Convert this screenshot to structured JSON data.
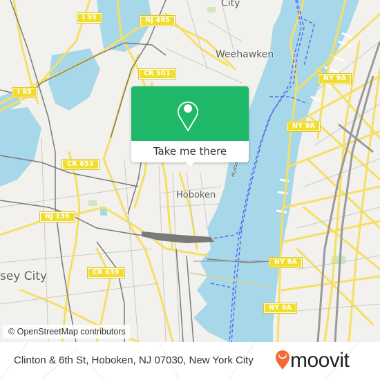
{
  "map": {
    "place_labels": [
      {
        "name": "union-city-label",
        "text": "City"
      },
      {
        "name": "weehawken-label",
        "text": "Weehawken"
      },
      {
        "name": "hoboken-label",
        "text": "Hoboken"
      },
      {
        "name": "jersey-city-label",
        "text": "sey City"
      },
      {
        "name": "hudson-river-label",
        "text": "Hudson River"
      }
    ],
    "road_shields": [
      {
        "name": "shield-i95-north",
        "text": "I 95"
      },
      {
        "name": "shield-nj495",
        "text": "NJ 495"
      },
      {
        "name": "shield-cr501",
        "text": "CR 501"
      },
      {
        "name": "shield-i95-west",
        "text": "I 95"
      },
      {
        "name": "shield-ny9a-1",
        "text": "NY 9A"
      },
      {
        "name": "shield-ny9a-2",
        "text": "NY 9A"
      },
      {
        "name": "shield-cr653",
        "text": "CR 653"
      },
      {
        "name": "shield-nj139",
        "text": "NJ 139"
      },
      {
        "name": "shield-cr639",
        "text": "CR 639"
      },
      {
        "name": "shield-ny9a-3",
        "text": "NY 9A"
      },
      {
        "name": "shield-ny9a-4",
        "text": "NY 9A"
      }
    ],
    "colors": {
      "land": "#f2f1ed",
      "water": "#a6d8ea",
      "road": "#f6df63",
      "ferry": "#5b6af0",
      "rail": "#808080",
      "park": "#cfe7b9"
    }
  },
  "popup": {
    "icon": "map-pin-icon",
    "button_label": "Take me there",
    "accent_color": "#1fb868"
  },
  "attribution": {
    "text": "© OpenStreetMap contributors"
  },
  "footer": {
    "address": "Clinton & 6th St, Hoboken, NJ 07030, New York City",
    "brand_name": "moovit",
    "brand_icon": "moovit-logo-icon",
    "brand_color": "#f26a35"
  }
}
